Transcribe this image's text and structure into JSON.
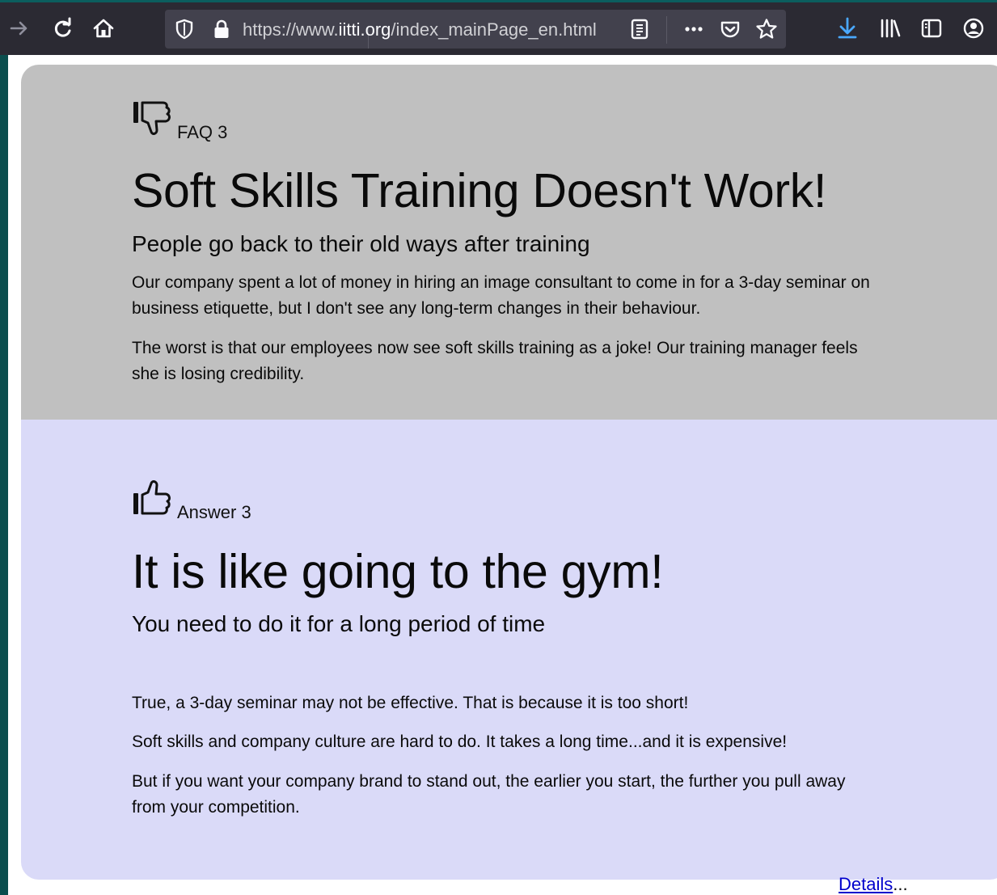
{
  "browser": {
    "url_prefix": "https://www.",
    "url_domain": "iitti.org",
    "url_path": "/index_mainPage_en.html",
    "icons": [
      "forward-icon",
      "reload-icon",
      "home-icon",
      "shield-icon",
      "lock-icon",
      "reader-view-icon",
      "more-icon",
      "pocket-icon",
      "bookmark-star-icon",
      "download-icon",
      "library-icon",
      "sidebar-icon",
      "account-icon"
    ]
  },
  "faq": {
    "kicker": "FAQ 3",
    "title": "Soft Skills Training Doesn't Work!",
    "subtitle": "People go back to their old ways after training",
    "paragraphs": [
      "Our company spent a lot of money in hiring an image consultant to come in for a 3-day seminar on business etiquette, but I don't see any long-term changes in their behaviour.",
      "The worst is that our employees now see soft skills training as a joke! Our training manager feels she is losing credibility."
    ]
  },
  "answer": {
    "kicker": "Answer 3",
    "title": "It is like going to the gym!",
    "subtitle": "You need to do it for a long period of time",
    "paragraphs": [
      "True, a 3-day seminar may not be effective. That is because it is too short!",
      "Soft skills and company culture are hard to do. It takes a long time...and it is expensive!",
      "But if you want your company brand to stand out, the earlier you start, the further you pull away from your competition."
    ],
    "details_link": "Details",
    "details_suffix": "..."
  },
  "colors": {
    "faq_bg": "#c0c0c0",
    "answer_bg": "#dadaf8",
    "link": "#0000cc",
    "download_icon": "#4aa8ff"
  }
}
